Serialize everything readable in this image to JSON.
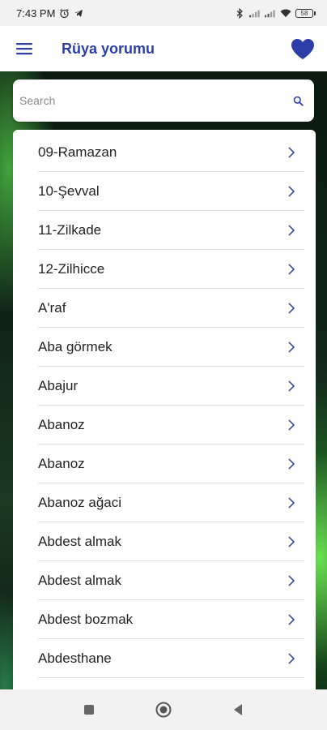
{
  "status_bar": {
    "time": "7:43 PM",
    "battery": "58",
    "icons": [
      "alarm-icon",
      "telegram-icon",
      "bluetooth-icon",
      "signal-icon",
      "signal-icon",
      "wifi-icon",
      "battery-icon"
    ]
  },
  "app_bar": {
    "title": "Rüya yorumu",
    "menu_icon": "hamburger-menu-icon",
    "favorite_icon": "heart-icon",
    "accent_color": "#2d3ea8"
  },
  "search": {
    "placeholder": "Search",
    "value": "",
    "icon": "search-icon"
  },
  "list": {
    "items": [
      {
        "label": "09-Ramazan"
      },
      {
        "label": "10-Şevval"
      },
      {
        "label": "11-Zilkade"
      },
      {
        "label": "12-Zilhicce"
      },
      {
        "label": "A'raf"
      },
      {
        "label": "Aba görmek"
      },
      {
        "label": "Abajur"
      },
      {
        "label": "Abanoz"
      },
      {
        "label": "Abanoz"
      },
      {
        "label": "Abanoz ağaci"
      },
      {
        "label": "Abdest almak"
      },
      {
        "label": "Abdest almak"
      },
      {
        "label": "Abdest bozmak"
      },
      {
        "label": "Abdesthane"
      }
    ],
    "item_icon": "chevron-right-icon"
  },
  "nav_bar": {
    "buttons": [
      "recents-square-icon",
      "home-circle-icon",
      "back-triangle-icon"
    ]
  }
}
